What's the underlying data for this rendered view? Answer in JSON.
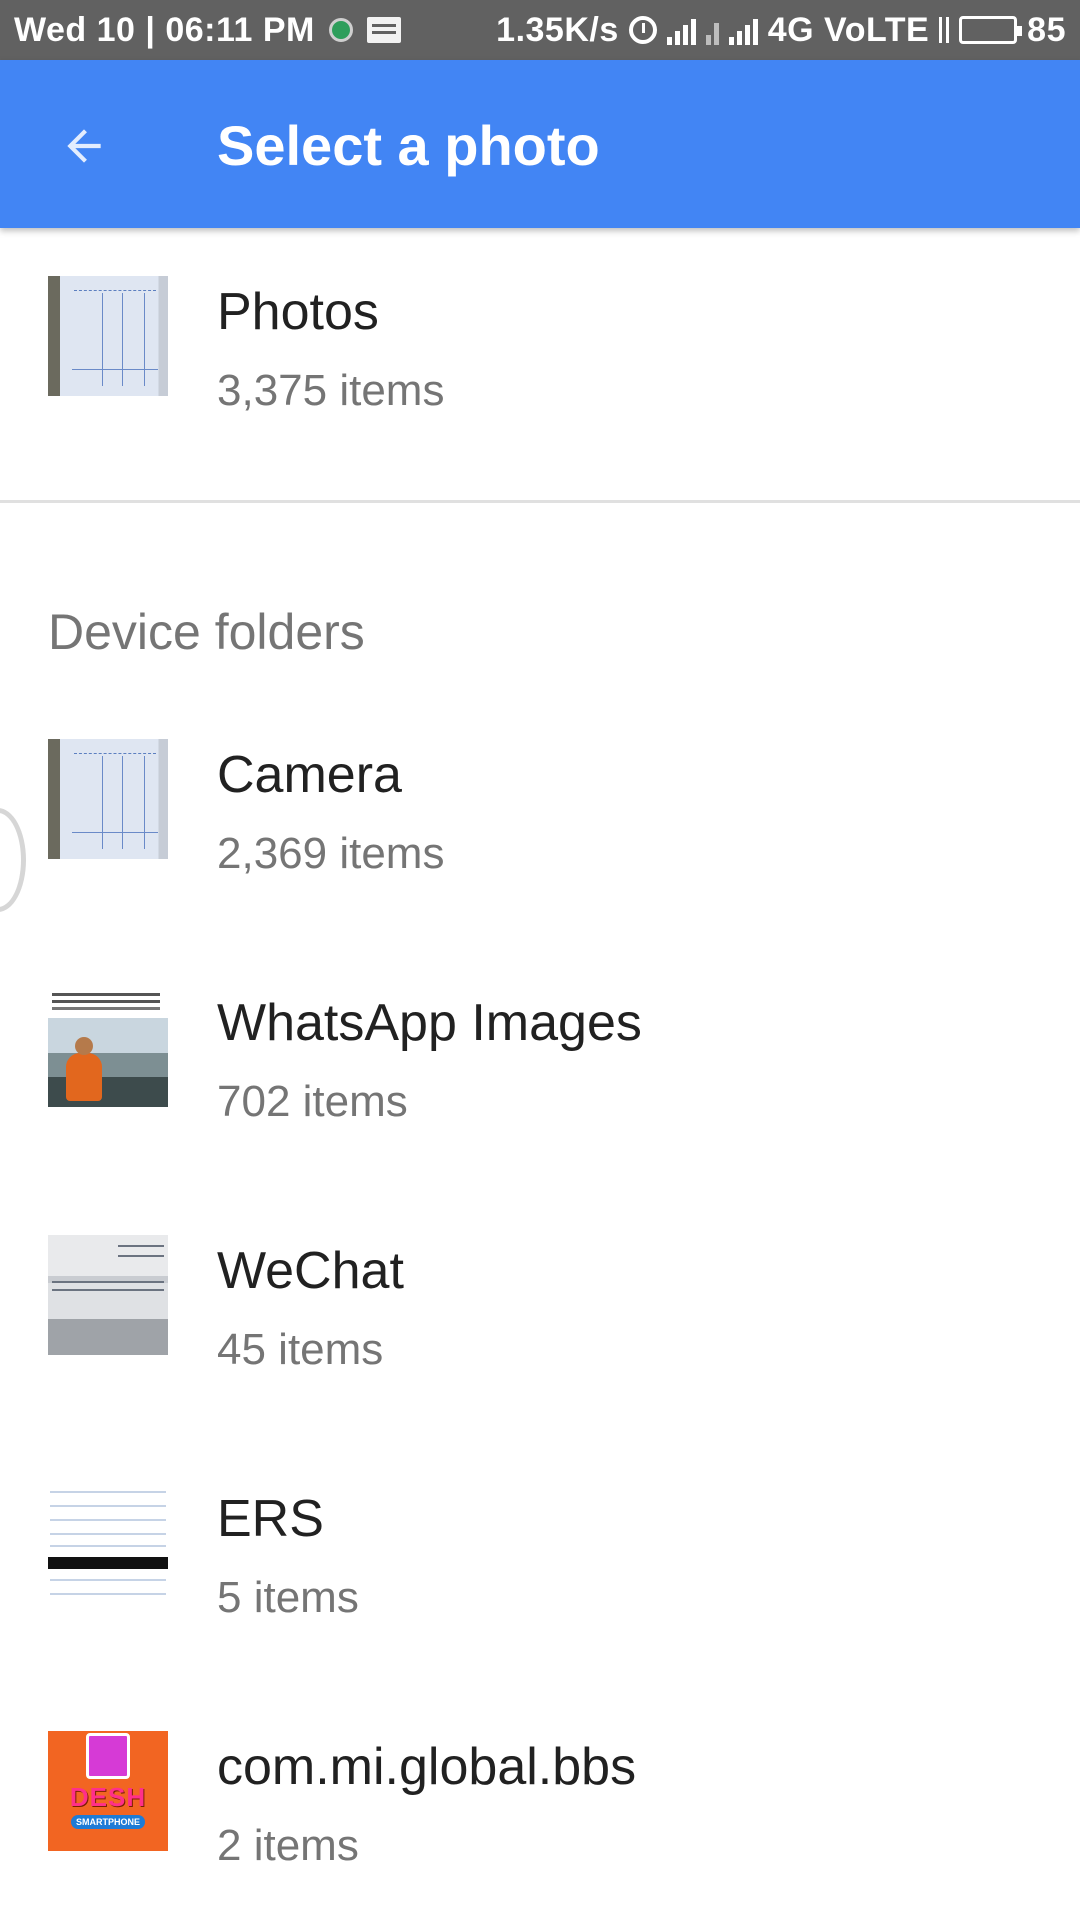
{
  "status_bar": {
    "left_text": "Wed 10 | 06:11 PM",
    "speed": "1.35K/s",
    "network": "4G VoLTE",
    "battery": "85",
    "icons": [
      "notification-dot-icon",
      "message-icon",
      "alarm-icon",
      "signal-icon",
      "battery-icon"
    ]
  },
  "app_bar": {
    "title": "Select a photo",
    "back_icon": "arrow-back-icon",
    "color": "#4285f4"
  },
  "top_album": {
    "name": "Photos",
    "count": "3,375 items"
  },
  "section": {
    "title": "Device folders"
  },
  "folders": [
    {
      "name": "Camera",
      "count": "2,369 items"
    },
    {
      "name": "WhatsApp Images",
      "count": "702 items"
    },
    {
      "name": "WeChat",
      "count": "45 items"
    },
    {
      "name": "ERS",
      "count": "5 items"
    },
    {
      "name": "com.mi.global.bbs",
      "count": "2 items"
    }
  ],
  "thumb_texts": {
    "bbs_line1": "DESH",
    "bbs_line2": "SMARTPHONE"
  }
}
